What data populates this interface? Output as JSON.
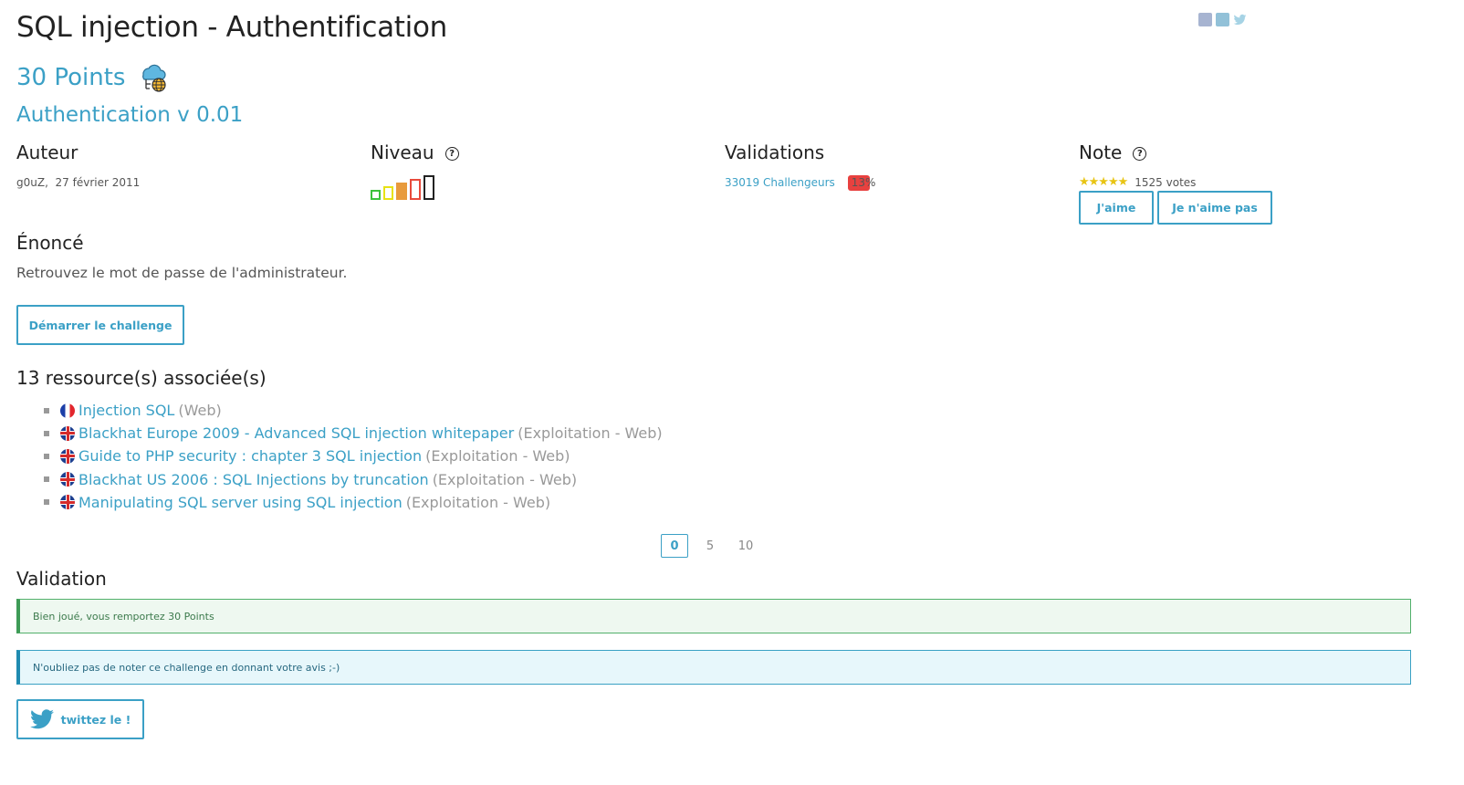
{
  "title": "SQL injection - Authentification",
  "points_label": "30 Points",
  "subtitle": "Authentication v 0.01",
  "author": {
    "heading": "Auteur",
    "name": "g0uZ,",
    "date": "27 février 2011"
  },
  "level": {
    "heading": "Niveau",
    "current": 3,
    "max": 5,
    "colors": [
      "#3cc13c",
      "#e8e214",
      "#e89a3c",
      "#e84b3c",
      "#222222"
    ]
  },
  "validations": {
    "heading": "Validations",
    "count_label": "33019 Challengeurs",
    "percent": "13%"
  },
  "note": {
    "heading": "Note",
    "stars": "★★★★★",
    "votes": "1525 votes",
    "like_label": "J'aime",
    "dislike_label": "Je n'aime pas"
  },
  "statement": {
    "heading": "Énoncé",
    "text": "Retrouvez le mot de passe de l'administrateur.",
    "start_button": "Démarrer le challenge"
  },
  "resources": {
    "heading": "13 ressource(s) associée(s)",
    "items": [
      {
        "flag": "fr",
        "title": "Injection SQL",
        "category": "(Web)"
      },
      {
        "flag": "uk",
        "title": "Blackhat Europe 2009 - Advanced SQL injection whitepaper",
        "category": "(Exploitation - Web)"
      },
      {
        "flag": "uk",
        "title": "Guide to PHP security : chapter 3 SQL injection",
        "category": "(Exploitation - Web)"
      },
      {
        "flag": "uk",
        "title": "Blackhat US 2006 : SQL Injections by truncation",
        "category": "(Exploitation - Web)"
      },
      {
        "flag": "uk",
        "title": "Manipulating SQL server using SQL injection",
        "category": "(Exploitation - Web)"
      }
    ]
  },
  "pagination": {
    "pages": [
      "0",
      "5",
      "10"
    ],
    "active": "0"
  },
  "validation": {
    "heading": "Validation",
    "success_message": "Bien joué, vous remportez 30 Points",
    "info_message": "N'oubliez pas de noter ce challenge en donnant votre avis ;-)",
    "tweet_label": "twittez le !"
  },
  "colors": {
    "accent": "#3ba0c6",
    "success": "#3e9b57",
    "info": "#1f8bb0",
    "danger": "#e8413f"
  }
}
